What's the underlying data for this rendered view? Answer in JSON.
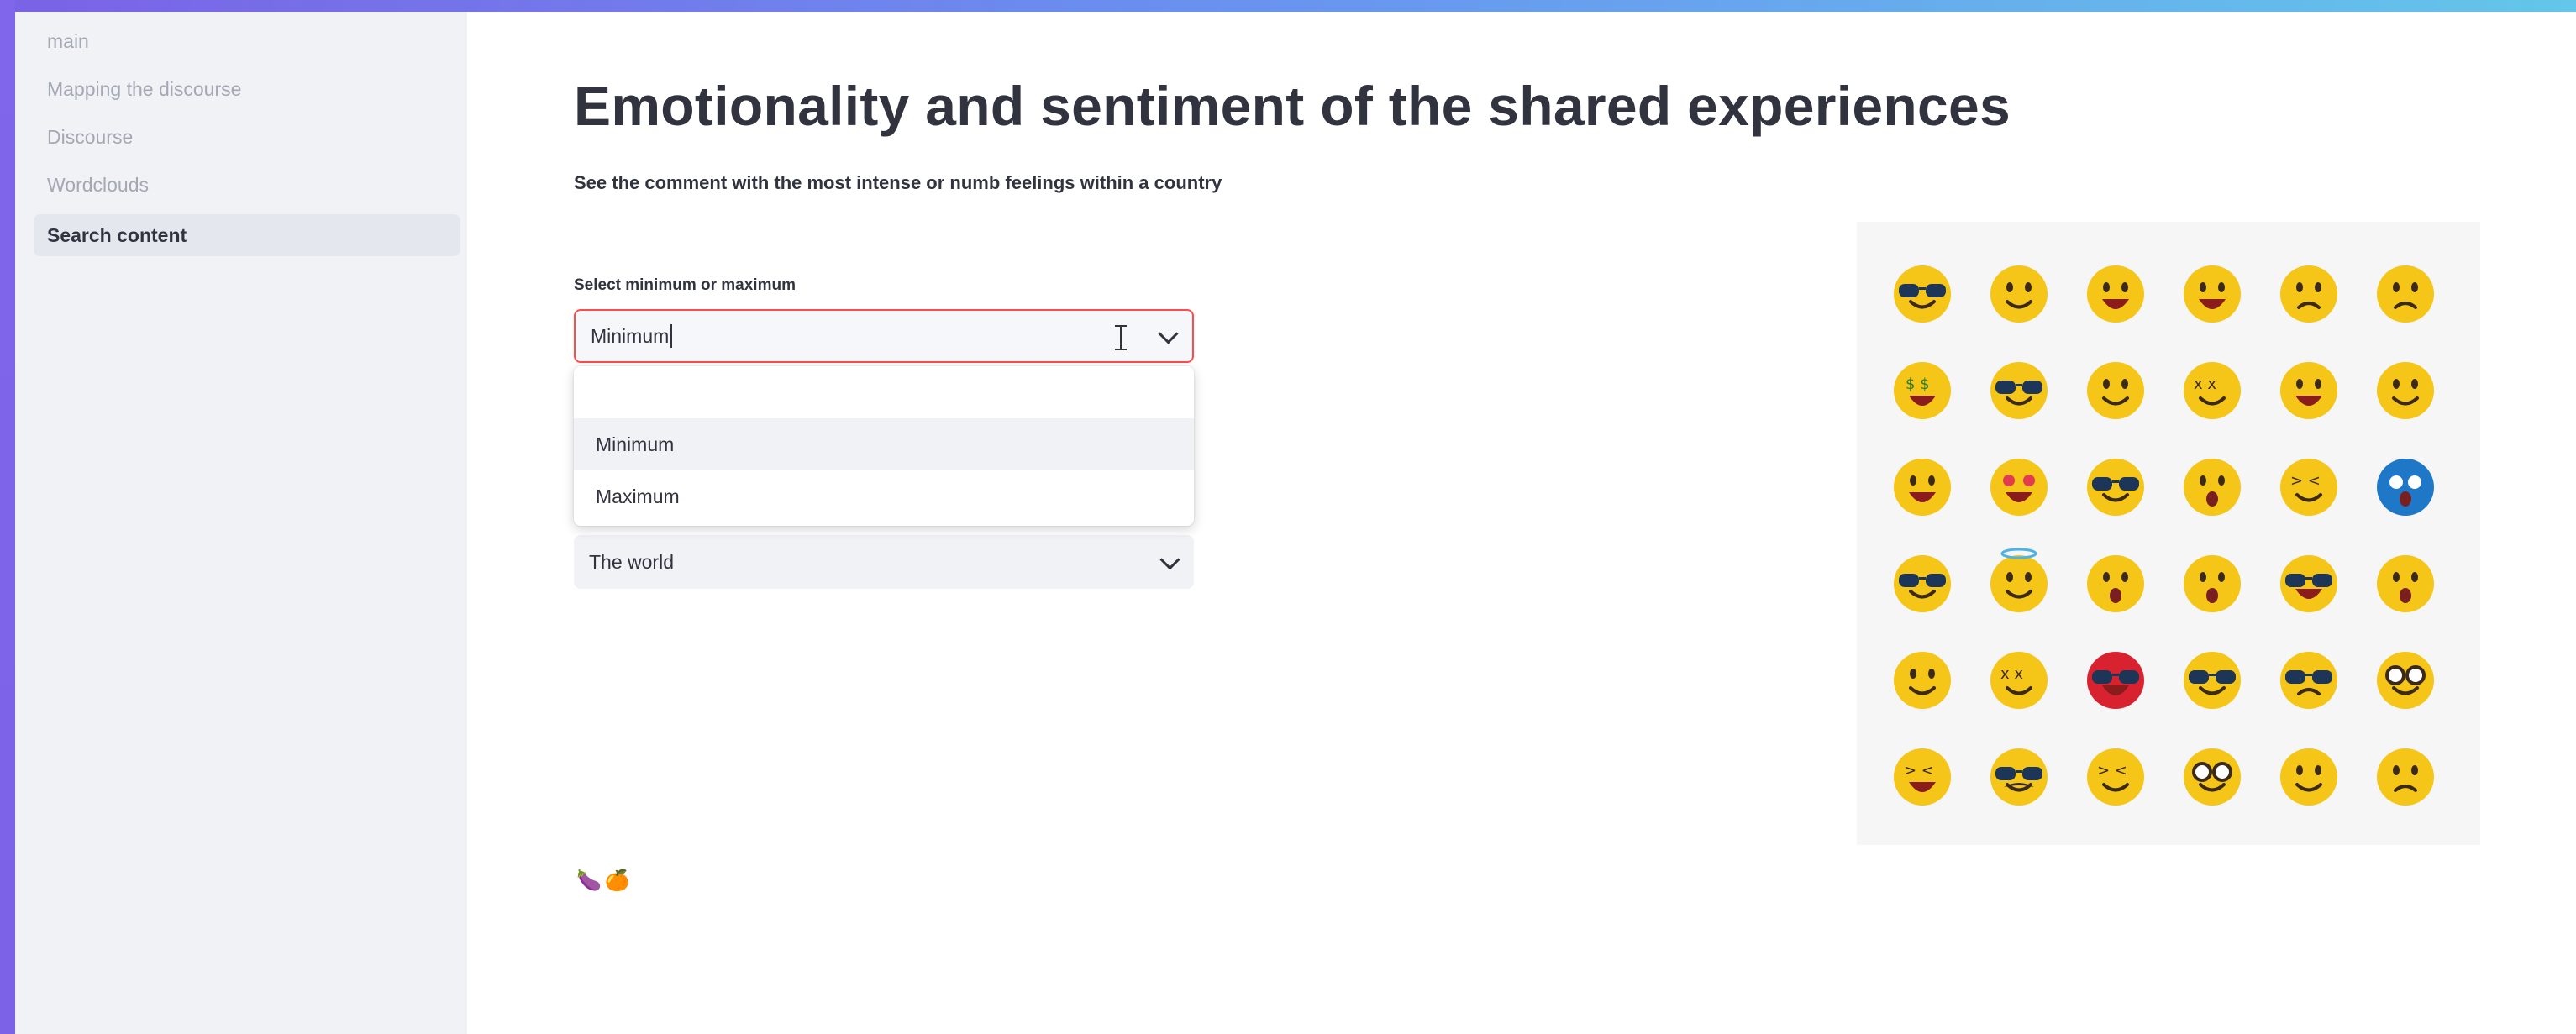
{
  "sidebar": {
    "items": [
      {
        "label": "main"
      },
      {
        "label": "Mapping the discourse"
      },
      {
        "label": "Discourse"
      },
      {
        "label": "Wordclouds"
      },
      {
        "label": "Search content",
        "active": true
      }
    ]
  },
  "main": {
    "title": "Emotionality and sentiment of the shared experiences",
    "subtitle": "See the comment with the most intense or numb feelings within a country",
    "minmax": {
      "label": "Select minimum or maximum",
      "value": "Minimum",
      "options": [
        "Minimum",
        "Maximum"
      ],
      "highlighted": "Minimum"
    },
    "country": {
      "value": "The world"
    },
    "icons": [
      "eggplant-icon",
      "orange-icon"
    ],
    "emoji_grid": {
      "rows": 6,
      "cols": 6,
      "emojis": [
        "sunglasses",
        "smile",
        "tongue",
        "tears-of-joy",
        "neutral",
        "worried",
        "money-mouth",
        "cool",
        "crying",
        "dizzy",
        "sweat-smile",
        "slight-smile",
        "grin",
        "heart-eyes",
        "nerd",
        "surprised",
        "nauseated",
        "scream",
        "shades",
        "halo",
        "zipper-mouth",
        "kiss",
        "cool-grin",
        "astonished",
        "drooling",
        "dizzy-eyes",
        "devil",
        "sunglasses",
        "frown",
        "monocle",
        "laughing",
        "mustache",
        "confounded",
        "glasses",
        "smile",
        "upside-down"
      ]
    }
  },
  "colors": {
    "accent": "#ff4b4b",
    "sidebar_bg": "#f0f2f6",
    "emoji_yellow": "#f5c518",
    "frame_gradient": [
      "#7b62e6",
      "#63c6ea"
    ]
  }
}
